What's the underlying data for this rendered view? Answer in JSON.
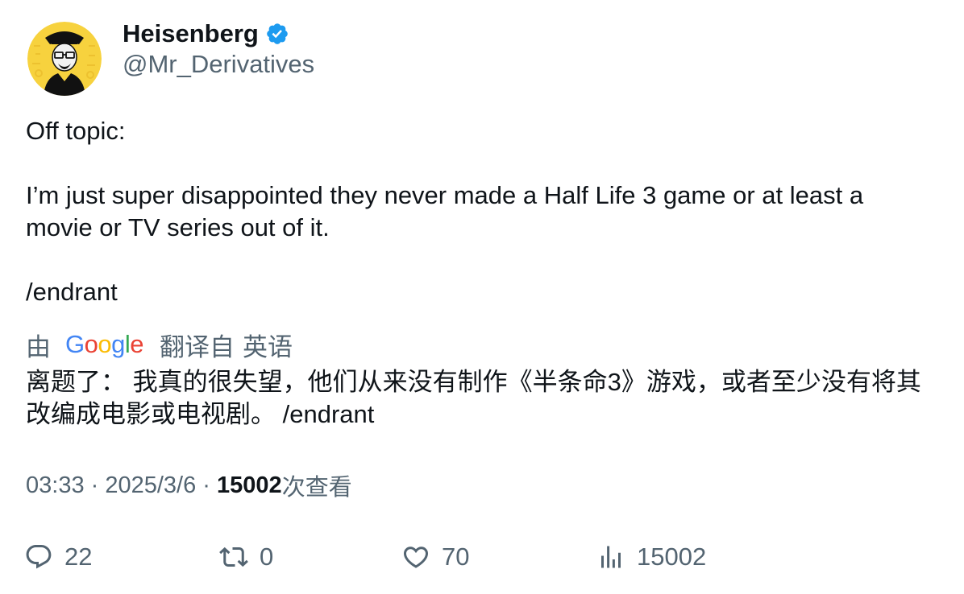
{
  "author": {
    "display_name": "Heisenberg",
    "handle": "@Mr_Derivatives",
    "verified_icon": "verified-badge-icon",
    "avatar_icon": "avatar-heisenberg-icon"
  },
  "tweet": {
    "lines": [
      "Off topic:",
      "I’m just super disappointed they never made a Half Life 3 game or at least a movie or TV series out of it.",
      "/endrant"
    ]
  },
  "translation": {
    "by_prefix": "由",
    "provider": "Google",
    "from_label": "翻译自",
    "language": "英语",
    "text": "离题了： 我真的很失望，他们从来没有制作《半条命3》游戏，或者至少没有将其改编成电影或电视剧。 /endrant"
  },
  "meta": {
    "time": "03:33",
    "separator": " · ",
    "date": "2025/3/6",
    "views": "15002",
    "views_suffix": "次查看"
  },
  "actions": {
    "reply_count": "22",
    "retweet_count": "0",
    "like_count": "70",
    "views_count": "15002"
  },
  "colors": {
    "text_primary": "#0f1419",
    "text_secondary": "#536471",
    "verified_blue": "#1d9bf0",
    "avatar_yellow": "#f7d23e"
  }
}
